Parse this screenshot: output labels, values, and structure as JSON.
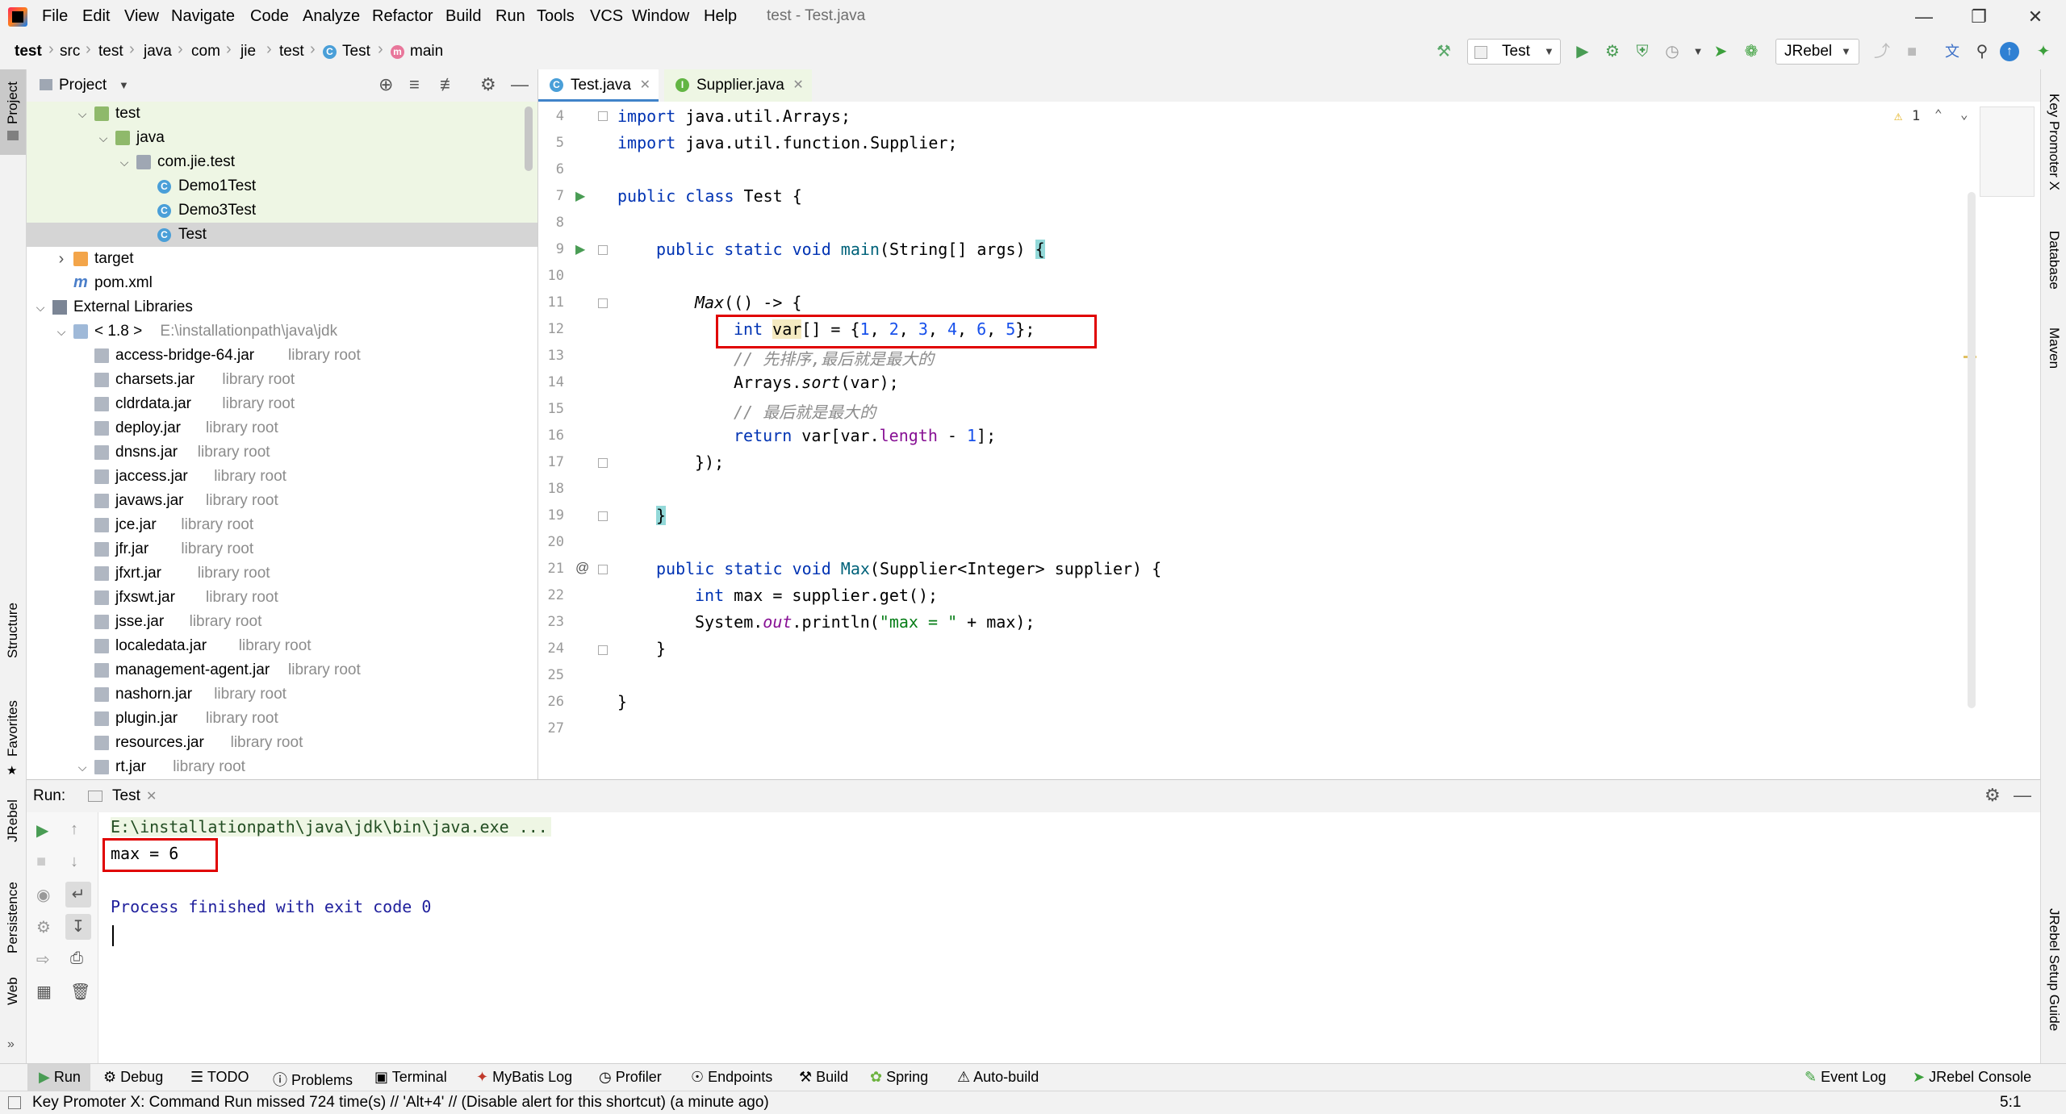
{
  "window": {
    "title": "test - Test.java",
    "menu": [
      "File",
      "Edit",
      "View",
      "Navigate",
      "Code",
      "Analyze",
      "Refactor",
      "Build",
      "Run",
      "Tools",
      "VCS",
      "Window",
      "Help"
    ]
  },
  "breadcrumb": [
    "test",
    "src",
    "test",
    "java",
    "com",
    "jie",
    "test",
    "Test",
    "main"
  ],
  "toolbar": {
    "run_config": "Test",
    "jrebel_config": "JRebel"
  },
  "project_panel": {
    "title": "Project",
    "tree": [
      {
        "label": "test",
        "indent": 2,
        "icon": "folder",
        "open": true,
        "bg": "green"
      },
      {
        "label": "java",
        "indent": 3,
        "icon": "folder",
        "open": true,
        "bg": "green"
      },
      {
        "label": "com.jie.test",
        "indent": 4,
        "icon": "package",
        "open": true,
        "bg": "green"
      },
      {
        "label": "Demo1Test",
        "indent": 5,
        "icon": "class",
        "bg": "green"
      },
      {
        "label": "Demo3Test",
        "indent": 5,
        "icon": "class",
        "bg": "green"
      },
      {
        "label": "Test",
        "indent": 5,
        "icon": "class",
        "bg": "selected"
      },
      {
        "label": "target",
        "indent": 1,
        "icon": "folder-orange",
        "open": false
      },
      {
        "label": "pom.xml",
        "indent": 1,
        "icon": "maven"
      },
      {
        "label": "External Libraries",
        "indent": 0,
        "icon": "library",
        "open": true
      },
      {
        "label": "< 1.8 >",
        "suffix": "E:\\installationpath\\java\\jdk",
        "indent": 1,
        "icon": "jdk",
        "open": true
      },
      {
        "label": "access-bridge-64.jar",
        "suffix": "library root",
        "indent": 2,
        "icon": "jar"
      },
      {
        "label": "charsets.jar",
        "suffix": "library root",
        "indent": 2,
        "icon": "jar"
      },
      {
        "label": "cldrdata.jar",
        "suffix": "library root",
        "indent": 2,
        "icon": "jar"
      },
      {
        "label": "deploy.jar",
        "suffix": "library root",
        "indent": 2,
        "icon": "jar"
      },
      {
        "label": "dnsns.jar",
        "suffix": "library root",
        "indent": 2,
        "icon": "jar"
      },
      {
        "label": "jaccess.jar",
        "suffix": "library root",
        "indent": 2,
        "icon": "jar"
      },
      {
        "label": "javaws.jar",
        "suffix": "library root",
        "indent": 2,
        "icon": "jar"
      },
      {
        "label": "jce.jar",
        "suffix": "library root",
        "indent": 2,
        "icon": "jar"
      },
      {
        "label": "jfr.jar",
        "suffix": "library root",
        "indent": 2,
        "icon": "jar"
      },
      {
        "label": "jfxrt.jar",
        "suffix": "library root",
        "indent": 2,
        "icon": "jar"
      },
      {
        "label": "jfxswt.jar",
        "suffix": "library root",
        "indent": 2,
        "icon": "jar"
      },
      {
        "label": "jsse.jar",
        "suffix": "library root",
        "indent": 2,
        "icon": "jar"
      },
      {
        "label": "localedata.jar",
        "suffix": "library root",
        "indent": 2,
        "icon": "jar"
      },
      {
        "label": "management-agent.jar",
        "suffix": "library root",
        "indent": 2,
        "icon": "jar"
      },
      {
        "label": "nashorn.jar",
        "suffix": "library root",
        "indent": 2,
        "icon": "jar"
      },
      {
        "label": "plugin.jar",
        "suffix": "library root",
        "indent": 2,
        "icon": "jar"
      },
      {
        "label": "resources.jar",
        "suffix": "library root",
        "indent": 2,
        "icon": "jar"
      },
      {
        "label": "rt.jar",
        "suffix": "library root",
        "indent": 2,
        "icon": "jar",
        "open": true
      }
    ]
  },
  "editor": {
    "tabs": [
      {
        "label": "Test.java",
        "active": true
      },
      {
        "label": "Supplier.java",
        "active": false
      }
    ],
    "warning_count": "1",
    "line_numbers": [
      "4",
      "5",
      "6",
      "7",
      "8",
      "9",
      "10",
      "11",
      "12",
      "13",
      "14",
      "15",
      "16",
      "17",
      "18",
      "19",
      "20",
      "21",
      "22",
      "23",
      "24",
      "25",
      "26",
      "27"
    ],
    "code": {
      "l4": "import java.util.Arrays;",
      "l5": "import java.util.function.Supplier;",
      "l7": "public class Test {",
      "l9": "public static void main(String[] args) {",
      "l11": "Max(() -> {",
      "l12": "int var[] = {1, 2, 3, 4, 6, 5};",
      "l13": "// 先排序,最后就是最大的",
      "l14": "Arrays.sort(var);",
      "l15": "// 最后就是最大的",
      "l16": "return var[var.length - 1];",
      "l17": "});",
      "l19": "}",
      "l21": "public static void Max(Supplier<Integer> supplier) {",
      "l22": "int max = supplier.get();",
      "l23": "System.out.println(\"max = \" + max);",
      "l24": "}",
      "l26": "}"
    }
  },
  "run_panel": {
    "label": "Run:",
    "tab": "Test",
    "console": {
      "command": "E:\\installationpath\\java\\jdk\\bin\\java.exe ...",
      "output": "max = 6",
      "exit": "Process finished with exit code 0"
    }
  },
  "left_strip": [
    "Project",
    "Structure",
    "Favorites",
    "JRebel",
    "Persistence",
    "Web"
  ],
  "right_strip": [
    "Key Promoter X",
    "Database",
    "Maven",
    "JRebel Setup Guide"
  ],
  "bottom_tools": [
    "Run",
    "Debug",
    "TODO",
    "Problems",
    "Terminal",
    "MyBatis Log",
    "Profiler",
    "Endpoints",
    "Build",
    "Spring",
    "Auto-build"
  ],
  "bottom_right_tools": [
    "Event Log",
    "JRebel Console"
  ],
  "status": {
    "message": "Key Promoter X: Command Run missed 724 time(s) // 'Alt+4' // (Disable alert for this shortcut) (a minute ago)",
    "position": "5:1"
  }
}
